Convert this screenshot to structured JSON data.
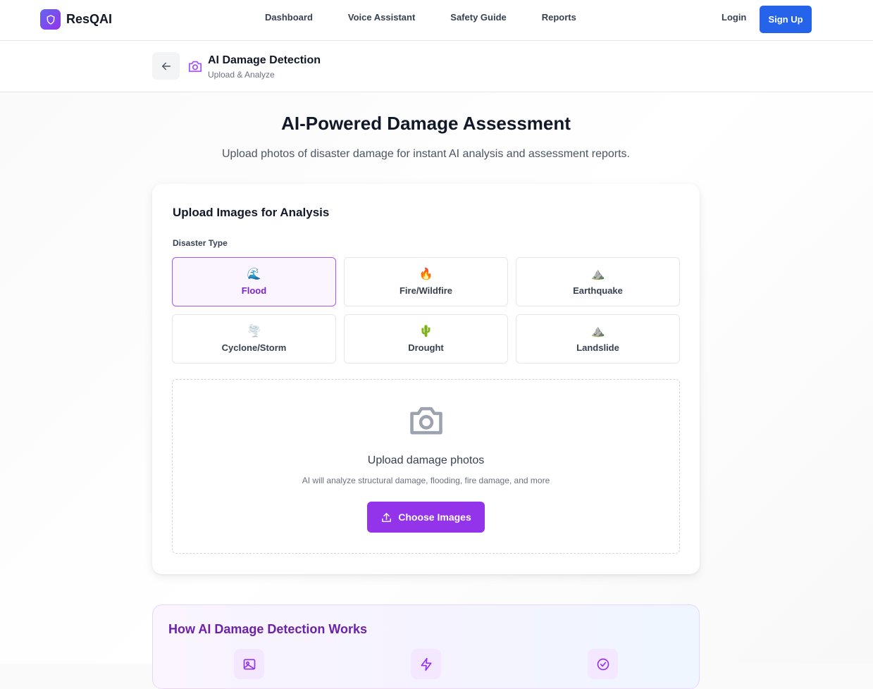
{
  "nav": {
    "brand": "ResQAI",
    "links": [
      "Dashboard",
      "Voice Assistant",
      "Safety Guide",
      "Reports"
    ],
    "login": "Login",
    "signup": "Sign Up"
  },
  "subheader": {
    "title": "AI Damage Detection",
    "subtitle": "Upload & Analyze"
  },
  "hero": {
    "title": "AI-Powered Damage Assessment",
    "subtitle": "Upload photos of disaster damage for instant AI analysis and assessment reports."
  },
  "upload_card": {
    "title": "Upload Images for Analysis",
    "disaster_type_label": "Disaster Type",
    "disaster_types": [
      {
        "emoji": "🌊",
        "label": "Flood",
        "selected": true
      },
      {
        "emoji": "🔥",
        "label": "Fire/Wildfire",
        "selected": false
      },
      {
        "emoji": "⛰️",
        "label": "Earthquake",
        "selected": false
      },
      {
        "emoji": "🌪️",
        "label": "Cyclone/Storm",
        "selected": false
      },
      {
        "emoji": "🌵",
        "label": "Drought",
        "selected": false
      },
      {
        "emoji": "⛰️",
        "label": "Landslide",
        "selected": false
      }
    ],
    "dropzone": {
      "title": "Upload damage photos",
      "subtitle": "AI will analyze structural damage, flooding, fire damage, and more",
      "button": "Choose Images"
    }
  },
  "how": {
    "title": "How AI Damage Detection Works"
  },
  "colors": {
    "primary_purple": "#9333ea",
    "signup_blue": "#2563eb",
    "selected_border": "#a855f7",
    "how_title": "#6b21a8"
  }
}
